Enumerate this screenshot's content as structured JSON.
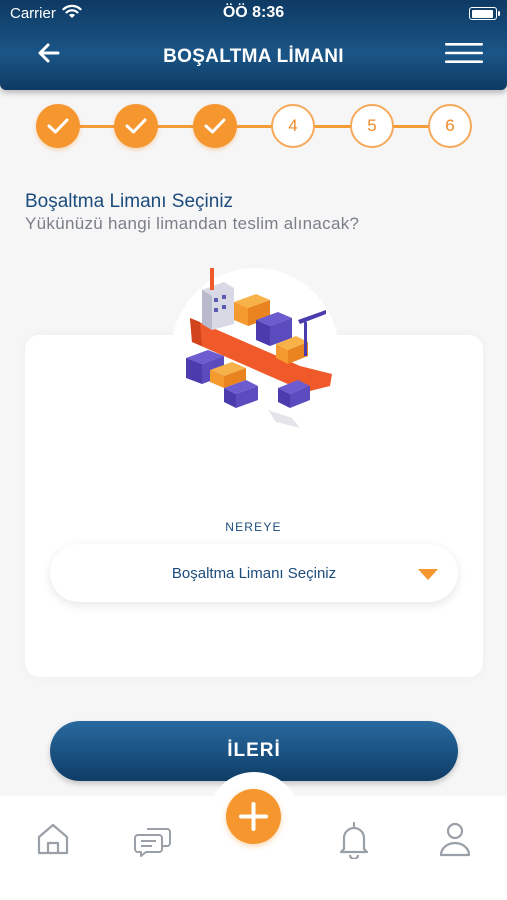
{
  "status_bar": {
    "carrier": "Carrier",
    "time": "ÖÖ 8:36"
  },
  "header": {
    "title": "BOŞALTMA LİMANI"
  },
  "steps": [
    {
      "state": "done",
      "label": ""
    },
    {
      "state": "done",
      "label": ""
    },
    {
      "state": "done",
      "label": ""
    },
    {
      "state": "todo",
      "label": "4"
    },
    {
      "state": "todo",
      "label": "5"
    },
    {
      "state": "todo",
      "label": "6"
    }
  ],
  "section": {
    "title": "Boşaltma Limanı Seçiniz",
    "subtitle": "Yükünüzü hangi limandan teslim alınacak?"
  },
  "form": {
    "field_label": "NEREYE",
    "select_value": "Boşaltma Limanı Seçiniz"
  },
  "actions": {
    "next_label": "İLERİ"
  },
  "tabbar": {
    "items": [
      "home-icon",
      "chat-icon",
      "add-icon",
      "bell-icon",
      "user-icon"
    ]
  },
  "colors": {
    "navy": "#1b5384",
    "orange": "#f5962e",
    "text_navy": "#1c4c7c",
    "gray_text": "#7a7f87"
  }
}
